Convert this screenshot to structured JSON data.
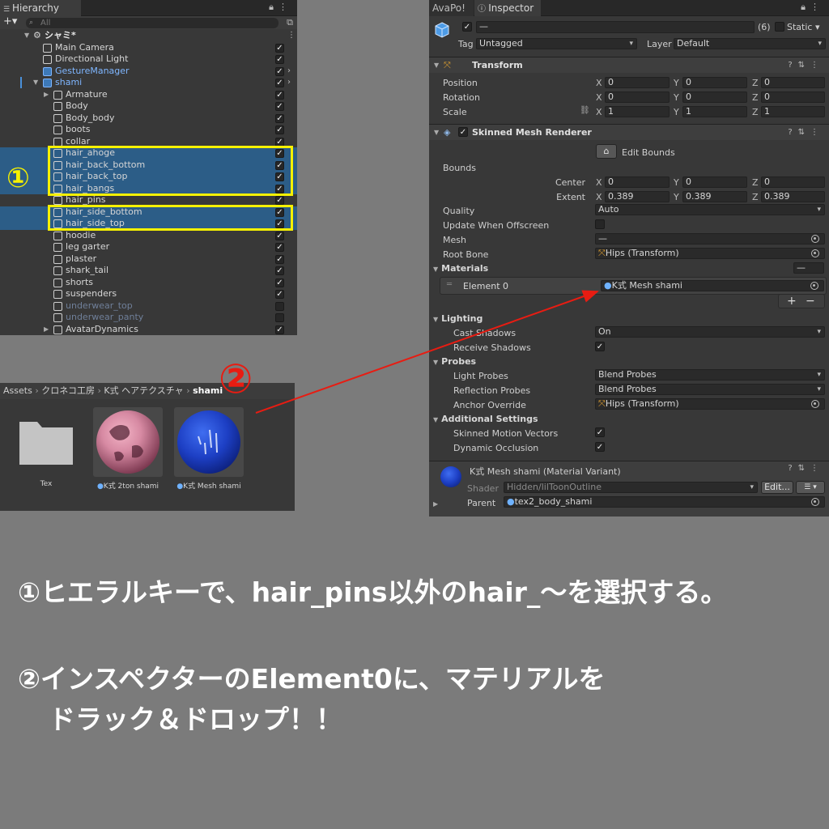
{
  "hierarchy": {
    "tab": "Hierarchy",
    "search_placeholder": "All",
    "scene": "シャミ*",
    "rows": [
      {
        "label": "Main Camera"
      },
      {
        "label": "Directional Light"
      },
      {
        "label": "GestureManager"
      },
      {
        "label": "shami"
      },
      {
        "label": "Armature"
      },
      {
        "label": "Body"
      },
      {
        "label": "Body_body"
      },
      {
        "label": "boots"
      },
      {
        "label": "collar"
      },
      {
        "label": "hair_ahoge"
      },
      {
        "label": "hair_back_bottom"
      },
      {
        "label": "hair_back_top"
      },
      {
        "label": "hair_bangs"
      },
      {
        "label": "hair_pins"
      },
      {
        "label": "hair_side_bottom"
      },
      {
        "label": "hair_side_top"
      },
      {
        "label": "hoodie"
      },
      {
        "label": "leg garter"
      },
      {
        "label": "plaster"
      },
      {
        "label": "shark_tail"
      },
      {
        "label": "shorts"
      },
      {
        "label": "suspenders"
      },
      {
        "label": "underwear_top"
      },
      {
        "label": "underwear_panty"
      },
      {
        "label": "AvatarDynamics"
      }
    ],
    "annotation_1": "①"
  },
  "project": {
    "breadcrumb": [
      "Assets",
      "クロネコ工房",
      "K式 ヘアテクスチャ",
      "shami"
    ],
    "assets": [
      {
        "label": "Tex"
      },
      {
        "label": "K式 2ton shami"
      },
      {
        "label": "K式 Mesh shami"
      }
    ]
  },
  "annotation_2": "②",
  "inspector": {
    "tabs": [
      "AvaPo!",
      "Inspector"
    ],
    "object_name": "—",
    "count": "(6)",
    "static_label": "Static",
    "tag_label": "Tag",
    "tag_value": "Untagged",
    "layer_label": "Layer",
    "layer_value": "Default",
    "transform": {
      "title": "Transform",
      "position": {
        "label": "Position",
        "x": "0",
        "y": "0",
        "z": "0"
      },
      "rotation": {
        "label": "Rotation",
        "x": "0",
        "y": "0",
        "z": "0"
      },
      "scale": {
        "label": "Scale",
        "x": "1",
        "y": "1",
        "z": "1"
      }
    },
    "smr": {
      "title": "Skinned Mesh Renderer",
      "edit_bounds": "Edit Bounds",
      "bounds_label": "Bounds",
      "center": {
        "label": "Center",
        "x": "0",
        "y": "0",
        "z": "0"
      },
      "extent": {
        "label": "Extent",
        "x": "0.389",
        "y": "0.389",
        "z": "0.389"
      },
      "quality_label": "Quality",
      "quality_value": "Auto",
      "update_offscreen": "Update When Offscreen",
      "mesh_label": "Mesh",
      "mesh_value": "—",
      "root_bone_label": "Root Bone",
      "root_bone_value": "Hips (Transform)",
      "materials_label": "Materials",
      "materials_count": "—",
      "element0_label": "Element 0",
      "element0_value": "K式 Mesh shami",
      "plus": "+",
      "minus": "−",
      "lighting": "Lighting",
      "cast_shadows_label": "Cast Shadows",
      "cast_shadows_value": "On",
      "receive_shadows": "Receive Shadows",
      "probes": "Probes",
      "light_probes_label": "Light Probes",
      "light_probes_value": "Blend Probes",
      "reflection_probes_label": "Reflection Probes",
      "reflection_probes_value": "Blend Probes",
      "anchor_override_label": "Anchor Override",
      "anchor_override_value": "Hips (Transform)",
      "additional": "Additional Settings",
      "skinned_motion": "Skinned Motion Vectors",
      "dynamic_occlusion": "Dynamic Occlusion"
    },
    "material": {
      "title": "K式 Mesh shami (Material Variant)",
      "shader_label": "Shader",
      "shader_value": "Hidden/lilToonOutline",
      "edit_button": "Edit...",
      "parent_label": "Parent",
      "parent_value": "tex2_body_shami"
    }
  },
  "instructions": {
    "line1": "①ヒエラルキーで、hair_pins以外のhair_～を選択する。",
    "line2": "②インスペクターのElement0に、マテリアルを",
    "line3": "ドラック＆ドロップ！！"
  },
  "colors": {
    "selection": "#2c5d87",
    "highlight_box": "#f6f100",
    "arrow": "#e81c12",
    "background": "#7b7b7b"
  }
}
